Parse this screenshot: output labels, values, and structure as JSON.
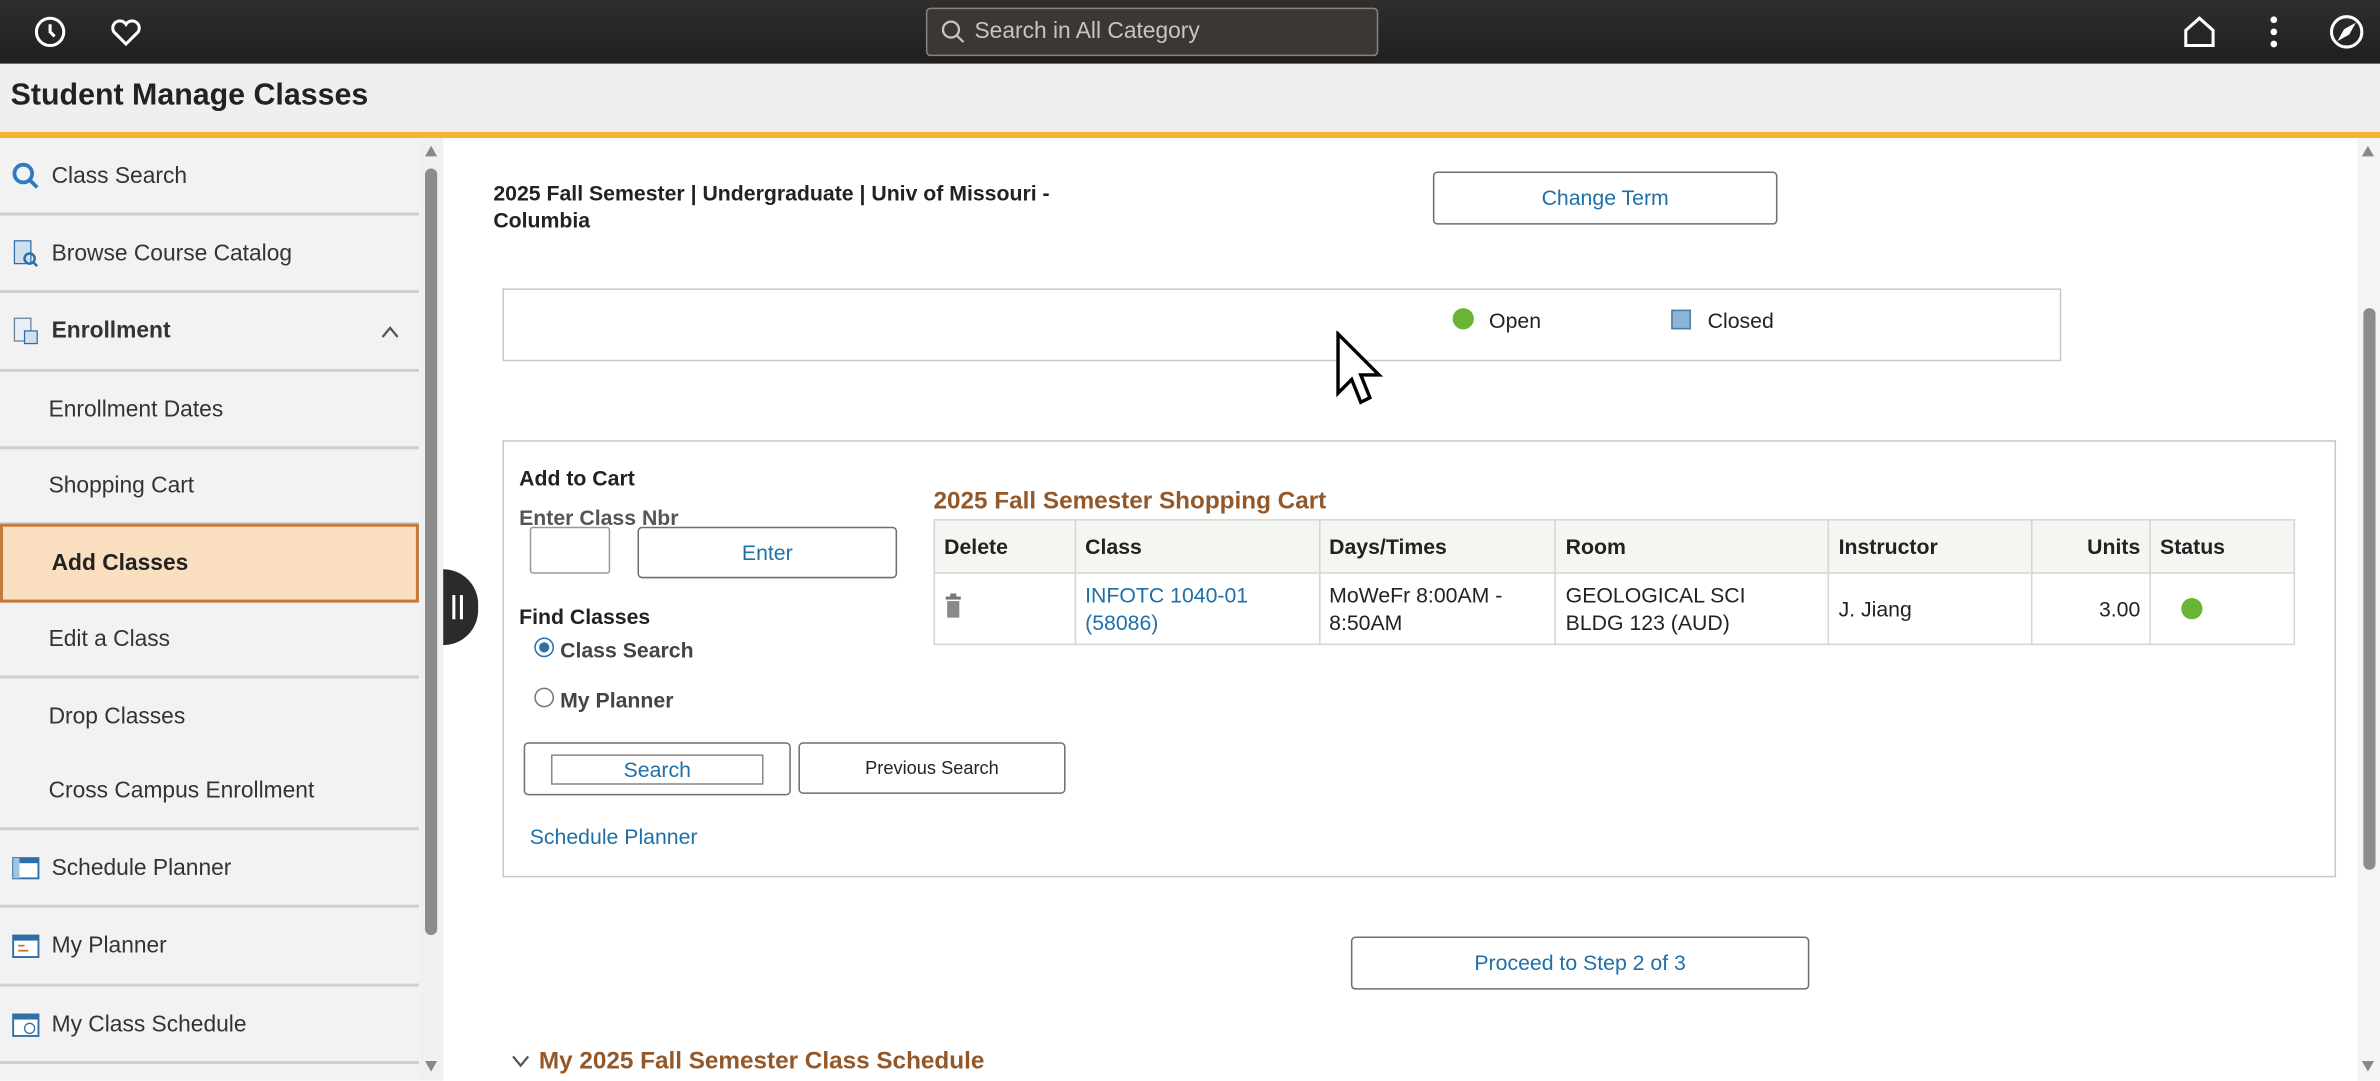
{
  "topbar": {
    "search_placeholder": "Search in All Category"
  },
  "title": "Student Manage Classes",
  "sidebar": {
    "items": [
      {
        "label": "Class Search",
        "icon": "search-icon"
      },
      {
        "label": "Browse Course Catalog",
        "icon": "catalog-icon"
      },
      {
        "label": "Enrollment",
        "icon": "enrollment-icon"
      },
      {
        "label": "Enrollment Dates"
      },
      {
        "label": "Shopping Cart"
      },
      {
        "label": "Add Classes",
        "selected": true
      },
      {
        "label": "Edit a Class"
      },
      {
        "label": "Drop Classes"
      },
      {
        "label": "Cross Campus Enrollment"
      },
      {
        "label": "Schedule Planner",
        "icon": "planner-icon"
      },
      {
        "label": "My Planner",
        "icon": "calendar-icon"
      },
      {
        "label": "My Class Schedule",
        "icon": "schedule-icon"
      }
    ]
  },
  "main": {
    "term_line1": "2025 Fall Semester | Undergraduate | Univ of Missouri -",
    "term_line2": "Columbia",
    "change_term": "Change Term",
    "legend": {
      "open": "Open",
      "closed": "Closed",
      "open_color": "#6ab534",
      "closed_color": "#8fb3d6"
    },
    "add_to_cart": "Add to Cart",
    "enter_class_nbr": "Enter Class Nbr",
    "class_nbr_value": "",
    "enter": "Enter",
    "find_classes": "Find Classes",
    "radio_class_search": "Class Search",
    "radio_my_planner": "My Planner",
    "search": "Search",
    "previous_search": "Previous Search",
    "schedule_planner": "Schedule Planner",
    "cart_title": "2025 Fall Semester Shopping Cart",
    "cart_headers": [
      "Delete",
      "Class",
      "Days/Times",
      "Room",
      "Instructor",
      "Units",
      "Status"
    ],
    "cart_rows": [
      {
        "class1": "INFOTC 1040-01",
        "class2": "(58086)",
        "days1": "MoWeFr 8:00AM -",
        "days2": "8:50AM",
        "room1": "GEOLOGICAL SCI",
        "room2": "BLDG 123 (AUD)",
        "instructor": "J. Jiang",
        "units": "3.00",
        "status": "Open"
      }
    ],
    "proceed": "Proceed to Step 2 of 3",
    "schedule_section": "My 2025 Fall Semester Class Schedule"
  }
}
